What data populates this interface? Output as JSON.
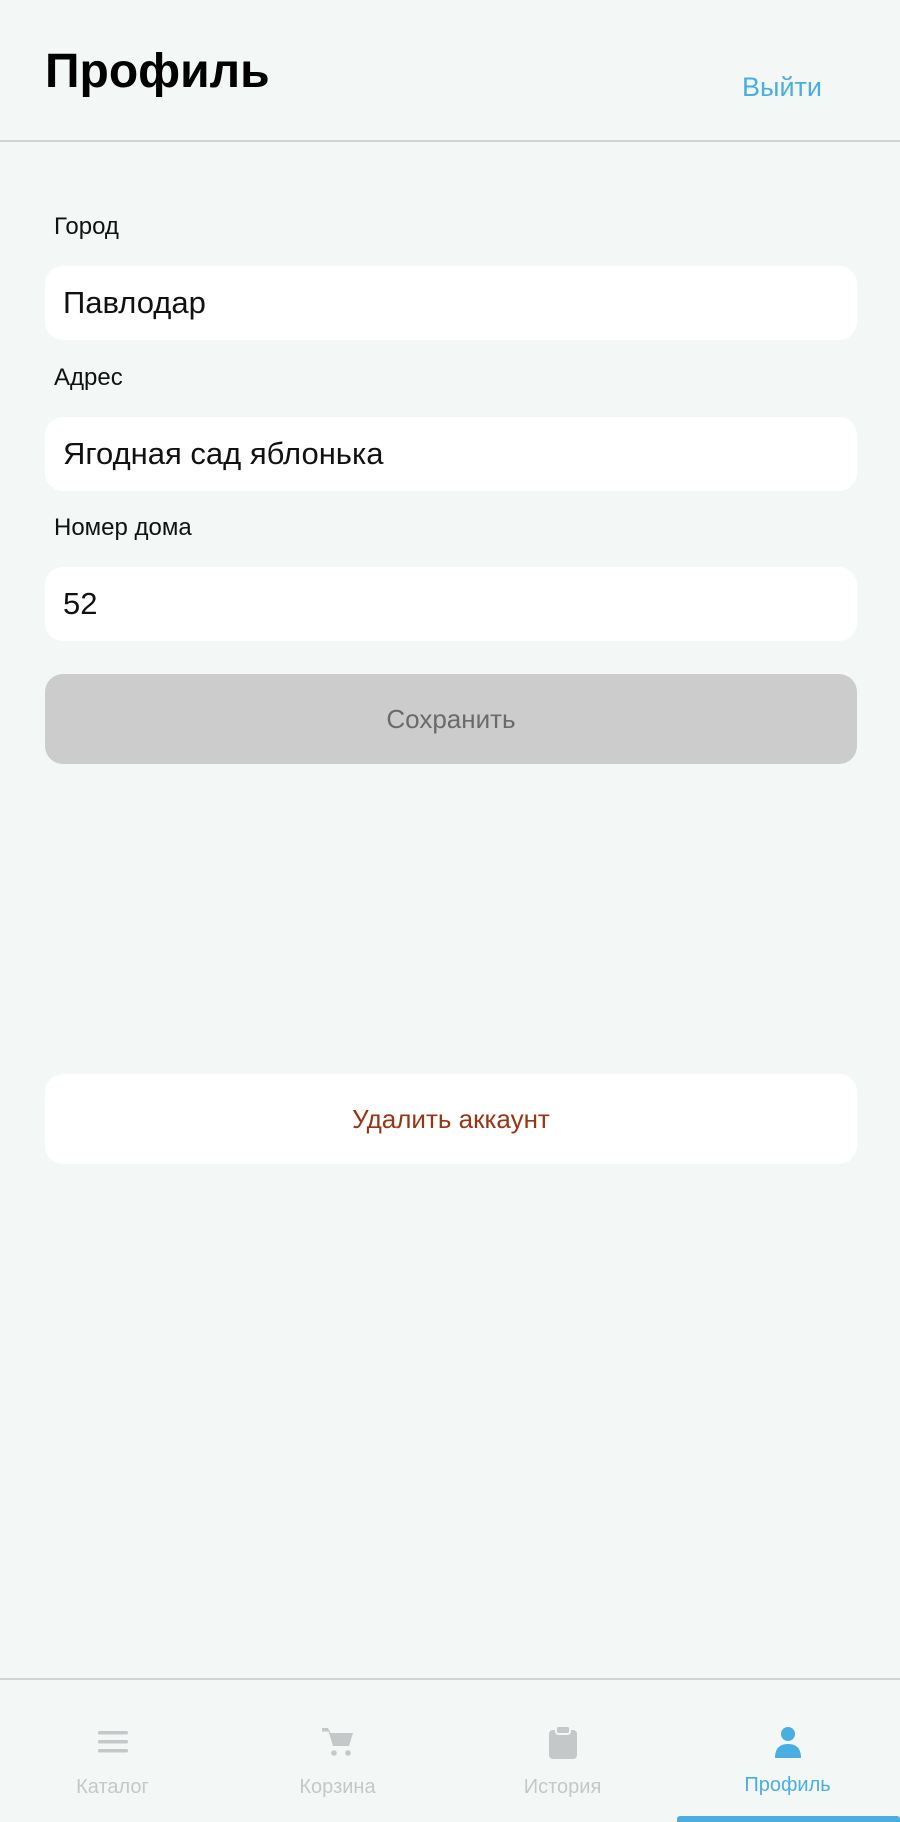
{
  "header": {
    "title": "Профиль",
    "logout_label": "Выйти"
  },
  "form": {
    "city": {
      "label": "Город",
      "value": "Павлодар"
    },
    "address": {
      "label": "Адрес",
      "value": "Ягодная сад яблонька"
    },
    "house_number": {
      "label": "Номер дома",
      "value": "52"
    },
    "save_label": "Сохранить",
    "delete_label": "Удалить аккаунт"
  },
  "tabbar": {
    "items": [
      {
        "label": "Каталог",
        "icon": "menu-icon"
      },
      {
        "label": "Корзина",
        "icon": "cart-icon"
      },
      {
        "label": "История",
        "icon": "clipboard-icon"
      },
      {
        "label": "Профиль",
        "icon": "user-icon"
      }
    ],
    "active_index": 3
  },
  "colors": {
    "accent": "#4aaee3",
    "background": "#f3f8f7",
    "danger": "#9a3412",
    "disabled_button": "#cccccc",
    "inactive_tab": "#c5c8c8"
  }
}
